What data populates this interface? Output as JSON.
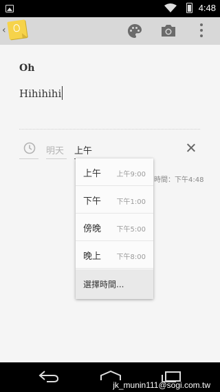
{
  "status_bar": {
    "time": "4:48"
  },
  "note": {
    "title": "Oh",
    "body": "Hihihihi"
  },
  "reminder": {
    "date": "明天",
    "time": "上午",
    "hint": "時間：下午4:48"
  },
  "dropdown": {
    "options": [
      {
        "label": "上午",
        "time": "上午9:00"
      },
      {
        "label": "下午",
        "time": "下午1:00"
      },
      {
        "label": "傍晚",
        "time": "下午5:00"
      },
      {
        "label": "晚上",
        "time": "下午8:00"
      }
    ],
    "custom_label": "選擇時間..."
  },
  "watermark": "jk_munin111@sogi.com.tw",
  "colors": {
    "action_bar": "#d8d8d8",
    "keep_yellow": "#f6d34a",
    "background": "#f5f5f5"
  }
}
